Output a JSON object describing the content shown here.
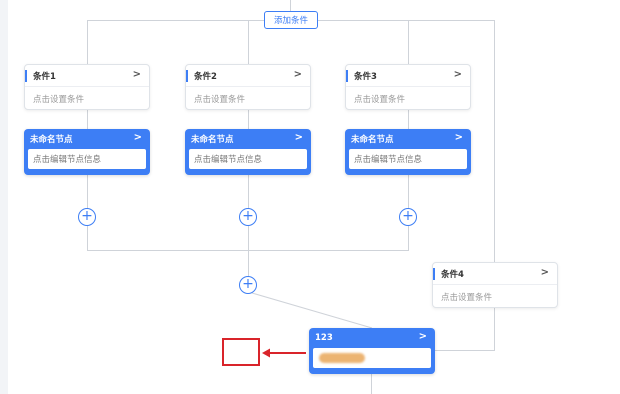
{
  "toolbar": {
    "add_condition_label": "添加条件"
  },
  "branches": [
    {
      "condition_title": "条件1",
      "condition_placeholder": "点击设置条件",
      "node_title": "未命名节点",
      "node_placeholder": "点击编辑节点信息"
    },
    {
      "condition_title": "条件2",
      "condition_placeholder": "点击设置条件",
      "node_title": "未命名节点",
      "node_placeholder": "点击编辑节点信息"
    },
    {
      "condition_title": "条件3",
      "condition_placeholder": "点击设置条件",
      "node_title": "未命名节点",
      "node_placeholder": "点击编辑节点信息"
    }
  ],
  "extra_condition": {
    "title": "条件4",
    "placeholder": "点击设置条件"
  },
  "bottom_node": {
    "title": "123"
  },
  "glyphs": {
    "arrow": ">",
    "plus": "+"
  },
  "colors": {
    "accent": "#3d7ef5",
    "annotation": "#d9242a",
    "redaction": "#e9a75a",
    "line": "#cfd3d9"
  },
  "icons": {
    "card_arrow": "chevron-right-icon",
    "add": "plus-circle-icon",
    "annotation_arrow": "red-arrow-icon"
  }
}
